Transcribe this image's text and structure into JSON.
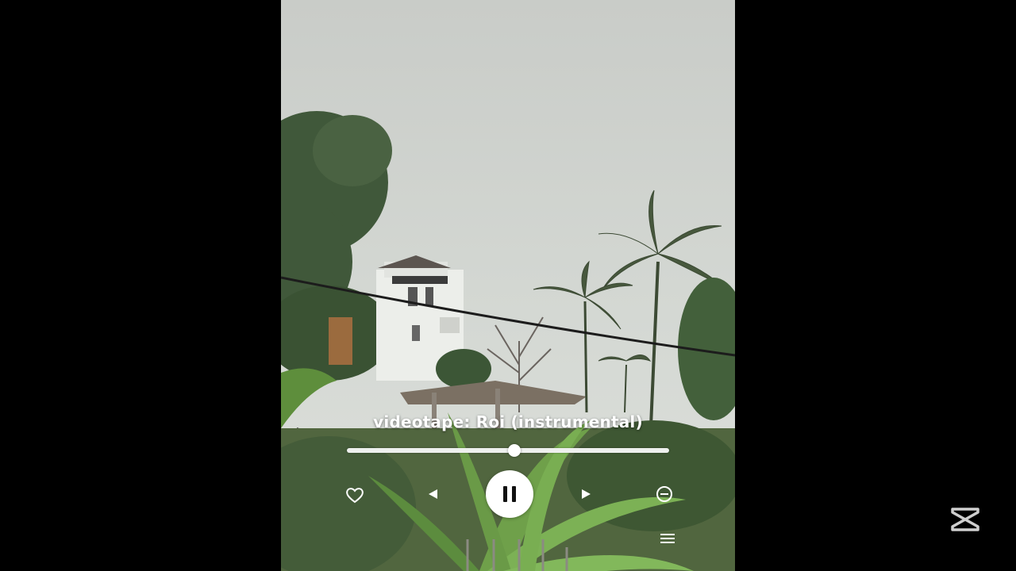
{
  "player": {
    "song_title": "videotape: Roi (instrumental)",
    "progress_fraction": 0.52,
    "state": "playing"
  },
  "icons": {
    "like": "heart-icon",
    "previous": "previous-icon",
    "play_pause": "pause-icon",
    "next": "next-icon",
    "remove": "minus-circle-icon",
    "queue": "queue-icon",
    "watermark": "capcut-logo-icon"
  },
  "colors": {
    "background": "#000000",
    "sky": "#cfd3cf",
    "foliage": "#3f5a34",
    "controls": "#ffffff"
  }
}
